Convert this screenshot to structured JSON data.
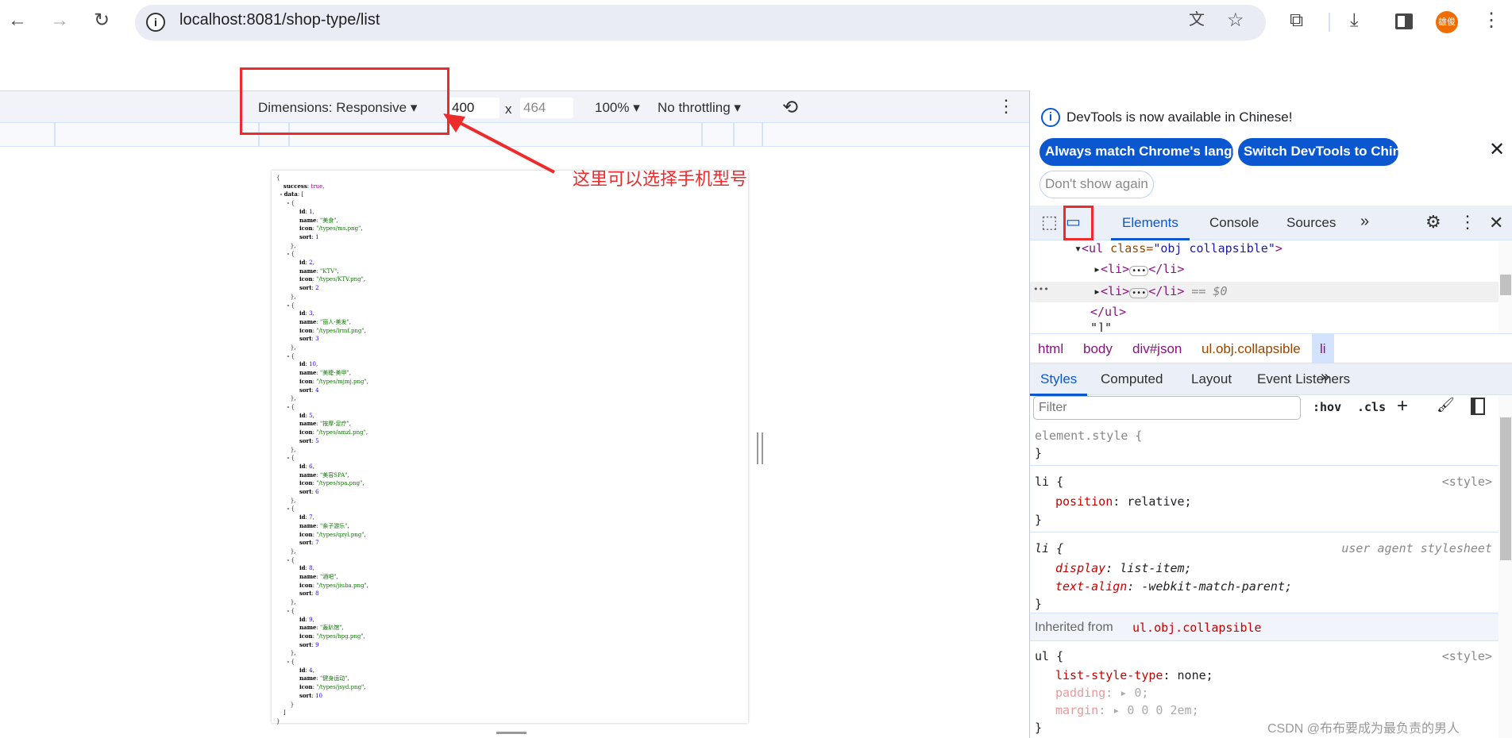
{
  "browser": {
    "url": "localhost:8081/shop-type/list",
    "avatar_text": "雄俊",
    "avatar_color": "#ef6c00"
  },
  "device_toolbar": {
    "dimensions": "Dimensions: Responsive",
    "width": "400",
    "times": "x",
    "height": "464",
    "zoom": "100%",
    "throttling": "No throttling"
  },
  "annotation": {
    "text": "这里可以选择手机型号",
    "color": "#ee2b2b"
  },
  "json_view": {
    "success_key": "success",
    "success_value": "true",
    "data_key": "data",
    "items": [
      {
        "id": 1,
        "name": "美食",
        "icon": "/types/ms.png",
        "sort": 1
      },
      {
        "id": 2,
        "name": "KTV",
        "icon": "/types/KTV.png",
        "sort": 2
      },
      {
        "id": 3,
        "name": "丽人·美发",
        "icon": "/types/lrmf.png",
        "sort": 3
      },
      {
        "id": 10,
        "name": "美睫·美甲",
        "icon": "/types/mjmj.png",
        "sort": 4
      },
      {
        "id": 5,
        "name": "按摩·足疗",
        "icon": "/types/amzl.png",
        "sort": 5
      },
      {
        "id": 6,
        "name": "美容SPA",
        "icon": "/types/spa.png",
        "sort": 6
      },
      {
        "id": 7,
        "name": "亲子游乐",
        "icon": "/types/qzyl.png",
        "sort": 7
      },
      {
        "id": 8,
        "name": "酒吧",
        "icon": "/types/jiuba.png",
        "sort": 8
      },
      {
        "id": 9,
        "name": "轰趴馆",
        "icon": "/types/hpg.png",
        "sort": 9
      },
      {
        "id": 4,
        "name": "健身运动",
        "icon": "/types/jsyd.png",
        "sort": 10
      }
    ]
  },
  "devtools": {
    "notice": "DevTools is now available in Chinese!",
    "btn_match": "Always match Chrome's language",
    "btn_switch": "Switch DevTools to Chinese",
    "btn_dont": "Don't show again",
    "tabs": [
      "Elements",
      "Console",
      "Sources"
    ],
    "tree": {
      "ul_open_tag": "<ul",
      "ul_attr": "class=",
      "ul_val": "\"obj collapsible\"",
      "ul_close": ">",
      "li_open": "<li>",
      "li_close": "</li>",
      "dollar": "== $0",
      "ul_end": "</ul>",
      "quote": "\"]\""
    },
    "breadcrumb": [
      "html",
      "body",
      "div#json",
      "ul.obj.collapsible",
      "li"
    ],
    "style_tabs": [
      "Styles",
      "Computed",
      "Layout",
      "Event Listeners"
    ],
    "filter_placeholder": "Filter",
    "hov": ":hov",
    "cls": ".cls",
    "rules": {
      "element_style": "element.style {",
      "close": "}",
      "li1_sel": "li {",
      "li1_src": "<style>",
      "li1_prop": "position",
      "li1_val": "relative;",
      "li2_sel": "li {",
      "li2_src": "user agent stylesheet",
      "li2_p1": "display",
      "li2_v1": "list-item;",
      "li2_p2": "text-align",
      "li2_v2": "-webkit-match-parent;",
      "inherited": "Inherited from",
      "inherited_sel": "ul.obj.collapsible",
      "ul_sel": "ul {",
      "ul_src": "<style>",
      "ul_p1": "list-style-type",
      "ul_v1": "none;",
      "ul_p2": "padding",
      "ul_v2": "0;",
      "ul_p3": "margin",
      "ul_v3": "0 0 0 2em;"
    }
  },
  "watermark": "CSDN @布布要成为最负责的男人"
}
